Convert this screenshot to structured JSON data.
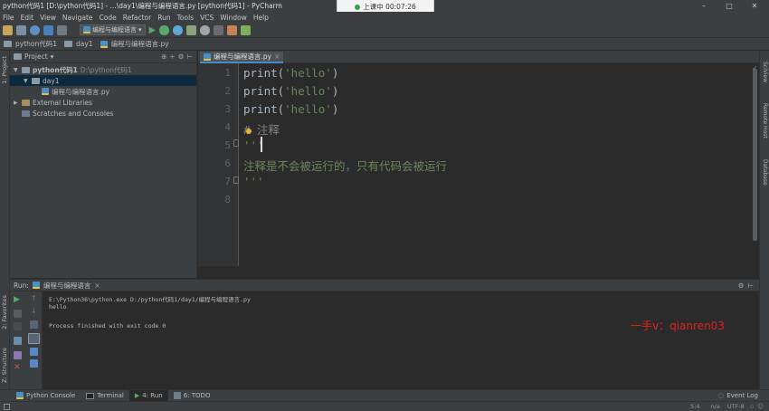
{
  "window": {
    "title": "python代码1 [D:\\python代码1] - ...\\day1\\编程与编程语言.py [python代码1] - PyCharm",
    "controls": [
      "–",
      "□",
      "✕"
    ]
  },
  "recording": {
    "label": "上课中 00:07:26"
  },
  "menu": [
    "File",
    "Edit",
    "View",
    "Navigate",
    "Code",
    "Refactor",
    "Run",
    "Tools",
    "VCS",
    "Window",
    "Help"
  ],
  "toolbar": {
    "run_config": "编程与编程语言"
  },
  "breadcrumb": [
    "python代码1",
    "day1",
    "编程与编程语言.py"
  ],
  "left_strip": {
    "project_tab": "1: Project",
    "favorites_tab": "2: Favorites",
    "structure_tab": "Z: Structure"
  },
  "right_strip": [
    "SciView",
    "Remote Host",
    "Database"
  ],
  "project": {
    "header": "Project",
    "tree": [
      {
        "label": "python代码1",
        "extra": "D:\\python代码1",
        "depth": 0,
        "arrow": "▼",
        "type": "folder",
        "bold": true
      },
      {
        "label": "day1",
        "extra": "",
        "depth": 1,
        "arrow": "▼",
        "type": "folder",
        "selected": true
      },
      {
        "label": "编程与编程语言.py",
        "extra": "",
        "depth": 2,
        "arrow": "",
        "type": "py"
      },
      {
        "label": "External Libraries",
        "extra": "",
        "depth": 0,
        "arrow": "▶",
        "type": "lib"
      },
      {
        "label": "Scratches and Consoles",
        "extra": "",
        "depth": 0,
        "arrow": "",
        "type": "scratch"
      }
    ]
  },
  "editor": {
    "tab": "编程与编程语言.py",
    "lines": [
      {
        "num": "1",
        "parts": [
          [
            "print(",
            ""
          ],
          [
            "'hello'",
            "str"
          ],
          [
            ")",
            ""
          ]
        ]
      },
      {
        "num": "2",
        "parts": [
          [
            "print(",
            ""
          ],
          [
            "'hello'",
            "str"
          ],
          [
            ")",
            ""
          ]
        ]
      },
      {
        "num": "3",
        "parts": [
          [
            "print(",
            ""
          ],
          [
            "'hello'",
            "str"
          ],
          [
            ")",
            ""
          ]
        ]
      },
      {
        "num": "4",
        "parts": [
          [
            "# 注释",
            "cmt"
          ]
        ]
      },
      {
        "num": "5",
        "parts": [
          [
            "'''",
            "str"
          ]
        ]
      },
      {
        "num": "6",
        "parts": [
          [
            "注释是不会被运行的，只有代码会被运行",
            "str"
          ]
        ]
      },
      {
        "num": "7",
        "parts": [
          [
            "'''",
            "str"
          ]
        ]
      },
      {
        "num": "8",
        "parts": []
      }
    ]
  },
  "run": {
    "label": "Run:",
    "tab": "编程与编程语言",
    "console": [
      "E:\\Python36\\python.exe D:/python代码1/day1/编程与编程语言.py",
      "hello",
      "",
      "Process finished with exit code 0"
    ],
    "watermark": "一手v：qianren03"
  },
  "bottom_tabs": [
    "Python Console",
    "Terminal",
    "4: Run",
    "6: TODO"
  ],
  "event_log": "Event Log",
  "status": {
    "position": "5:4",
    "separator": "n/a",
    "encoding": "UTF-8"
  }
}
